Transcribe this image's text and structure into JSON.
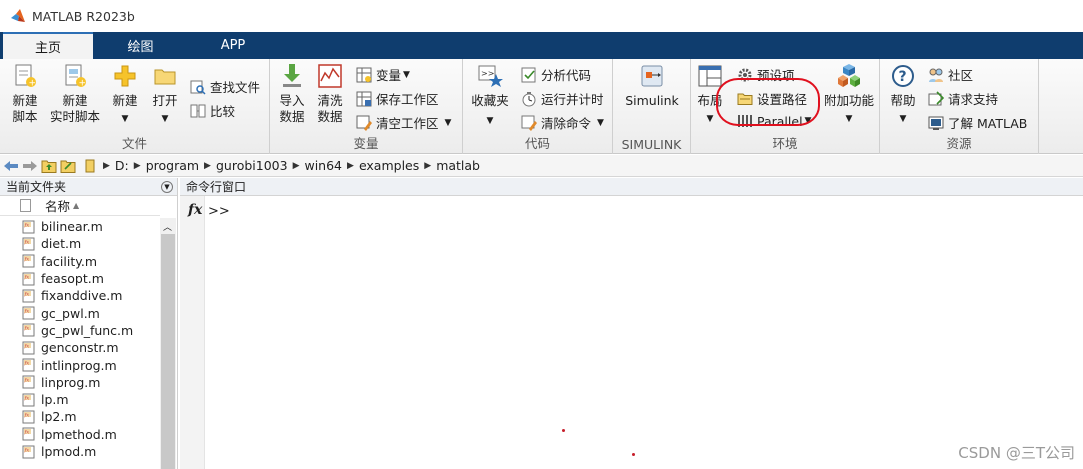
{
  "window": {
    "title": "MATLAB R2023b"
  },
  "tabs": [
    {
      "label": "主页",
      "active": true
    },
    {
      "label": "绘图",
      "active": false
    },
    {
      "label": "APP",
      "active": false
    }
  ],
  "ribbon": {
    "file_group": {
      "label": "文件",
      "new_script": "新建\n脚本",
      "new_live_script": "新建\n实时脚本",
      "new": "新建",
      "open": "打开",
      "find_files": "查找文件",
      "compare": "比较"
    },
    "variable_group": {
      "label": "变量",
      "import_data": "导入\n数据",
      "clean_data": "清洗\n数据",
      "variable": "变量",
      "save_workspace": "保存工作区",
      "clear_workspace": "清空工作区"
    },
    "code_group": {
      "label": "代码",
      "favorites": "收藏夹",
      "analyze_code": "分析代码",
      "run_and_time": "运行并计时",
      "clear_commands": "清除命令"
    },
    "simulink_group": {
      "label": "SIMULINK",
      "simulink": "Simulink"
    },
    "environment_group": {
      "label": "环境",
      "layout": "布局",
      "preferences": "预设项",
      "set_path": "设置路径",
      "parallel": "Parallel",
      "addons": "附加功能"
    },
    "resources_group": {
      "label": "资源",
      "help": "帮助",
      "community": "社区",
      "request_support": "请求支持",
      "learn_matlab": "了解 MATLAB"
    }
  },
  "address_bar": {
    "path": [
      "D:",
      "program",
      "gurobi1003",
      "win64",
      "examples",
      "matlab"
    ]
  },
  "current_folder": {
    "title": "当前文件夹",
    "name_column": "名称",
    "files": [
      "bilinear.m",
      "diet.m",
      "facility.m",
      "feasopt.m",
      "fixanddive.m",
      "gc_pwl.m",
      "gc_pwl_func.m",
      "genconstr.m",
      "intlinprog.m",
      "linprog.m",
      "lp.m",
      "lp2.m",
      "lpmethod.m",
      "lpmod.m"
    ]
  },
  "command_window": {
    "title": "命令行窗口",
    "fx": "fx",
    "prompt": ">>"
  },
  "watermark": "CSDN @三T公司",
  "colors": {
    "tab_bar": "#0f3d6e",
    "annotation": "#e0101e"
  }
}
